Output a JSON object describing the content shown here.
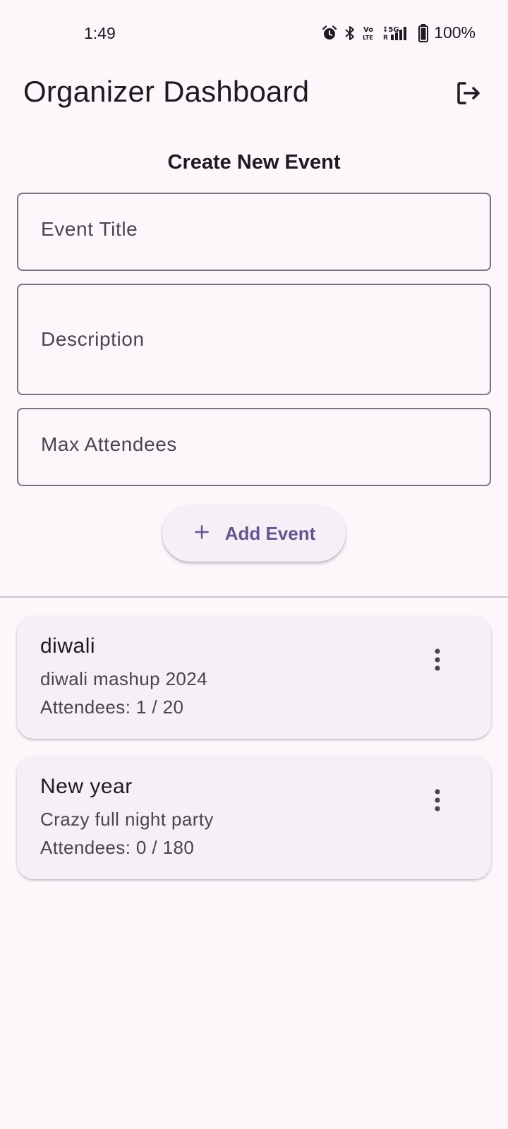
{
  "status_bar": {
    "time": "1:49",
    "battery": "100%",
    "icons": [
      "alarm-icon",
      "bluetooth-icon",
      "volte-icon",
      "signal-5g-icon",
      "battery-icon"
    ]
  },
  "app_bar": {
    "title": "Organizer Dashboard",
    "logout_icon": "logout-icon"
  },
  "form": {
    "heading": "Create New Event",
    "title_placeholder": "Event Title",
    "description_placeholder": "Description",
    "max_attendees_placeholder": "Max Attendees",
    "add_button_label": "Add Event",
    "add_button_icon": "plus-icon"
  },
  "events": [
    {
      "title": "diwali",
      "description": "diwali mashup 2024",
      "attendees": "Attendees: 1 / 20"
    },
    {
      "title": "New year",
      "description": "Crazy full night party",
      "attendees": "Attendees: 0 / 180"
    }
  ],
  "colors": {
    "background": "#fdf7fc",
    "accent": "#65558f",
    "outline": "#79747e",
    "card": "#f5f0f6"
  }
}
